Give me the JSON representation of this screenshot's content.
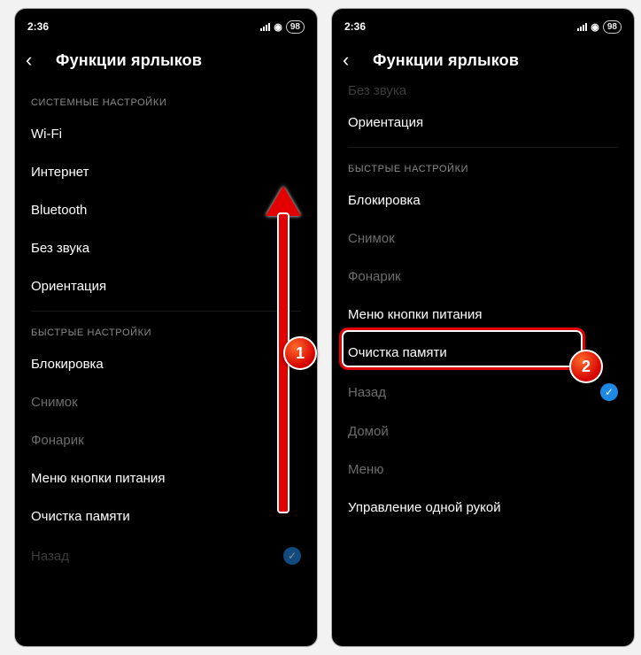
{
  "status": {
    "time": "2:36",
    "battery": "98"
  },
  "header": {
    "title": "Функции ярлыков"
  },
  "sections": {
    "system_label": "СИСТЕМНЫЕ НАСТРОЙКИ",
    "quick_label": "БЫСТРЫЕ НАСТРОЙКИ"
  },
  "items": {
    "wifi": "Wi-Fi",
    "internet": "Интернет",
    "bluetooth": "Bluetooth",
    "no_sound": "Без звука",
    "no_sound_trunc": "Без звука",
    "orientation": "Ориентация",
    "lock": "Блокировка",
    "screenshot": "Снимок",
    "flashlight": "Фонарик",
    "power_menu": "Меню кнопки питания",
    "clear_memory": "Очистка памяти",
    "back": "Назад",
    "home": "Домой",
    "menu": "Меню",
    "one_hand": "Управление одной рукой"
  },
  "badges": {
    "one": "1",
    "two": "2"
  }
}
